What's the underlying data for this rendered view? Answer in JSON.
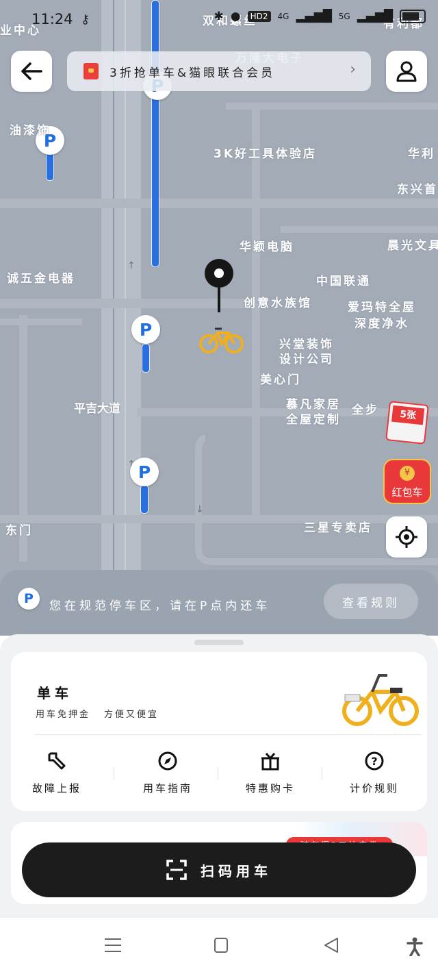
{
  "status_bar": {
    "time": "11:24",
    "icons": [
      "key-icon",
      "bluetooth-icon",
      "location-icon",
      "hd-icon",
      "signal-4g-icon",
      "signal-5g-icon",
      "battery-icon"
    ],
    "hd_label": "HD2",
    "net1": "4G",
    "net2": "5G"
  },
  "header": {
    "promo_text": "3折抢单车&猫眼联合会员"
  },
  "map": {
    "labels": {
      "l1": "双和螺丝",
      "l2": "万隆大电子",
      "l3": "油漆饰",
      "l4": "3K好工具体验店",
      "l5": "华颖电脑",
      "l6": "晨光文具",
      "l7": "诚五金电器",
      "l8": "中国联通",
      "l9": "创意水族馆",
      "l10": "爱玛特全屋",
      "l11": "深度净水",
      "l12": "兴堂装饰",
      "l13": "设计公司",
      "l14": "美心门",
      "l15": "慕凡家居",
      "l16": "全屋定制",
      "l17": "全步",
      "l18": "平吉大道",
      "l19": "三星专卖店",
      "l20": "东门",
      "l21": "华利",
      "l22": "东兴首",
      "l23": "业中心",
      "l24": "有利都"
    },
    "coupon_badge": "5张",
    "redpacket_label": "红包车"
  },
  "info_strip": {
    "text": "您在规范停车区，请在P点内还车",
    "rules_button": "查看规则"
  },
  "bike_card": {
    "title": "单车",
    "subtitle_a": "用车免押金",
    "subtitle_b": "方便又便宜",
    "actions": [
      "故障上报",
      "用车指南",
      "特惠购卡",
      "计价规则"
    ]
  },
  "coupon_tag": "骑车得3元外卖券",
  "scan_button": "扫码用车",
  "colors": {
    "map_bg": "#a3abb7",
    "parking_blue": "#2a6fe0",
    "accent_red": "#e8383a",
    "button_dark": "#1c1c1c"
  }
}
